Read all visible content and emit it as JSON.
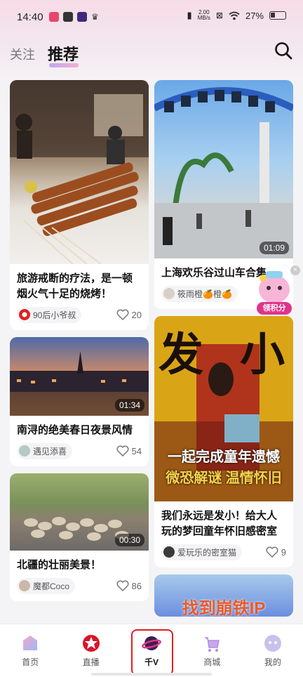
{
  "status_bar": {
    "time": "14:40",
    "net_speed_value": "2.00",
    "net_speed_unit": "MB/s",
    "battery": "27%"
  },
  "header": {
    "tab_follow": "关注",
    "tab_recommend": "推荐"
  },
  "feed": {
    "left": [
      {
        "title": "旅游戒断的疗法，是一顿烟火气十足的烧烤！",
        "author": "90后小爷叔",
        "likes": "20",
        "duration": ""
      },
      {
        "title": "南浔的绝美春日夜景风情",
        "author": "遇见添喜",
        "likes": "54",
        "duration": "01:34"
      },
      {
        "title": "北疆的壮丽美景！",
        "author": "魔都Coco",
        "likes": "86",
        "duration": "00:30"
      }
    ],
    "right": [
      {
        "title": "上海欢乐谷过山车合集",
        "author": "筱雨橙🍊橙🍊",
        "likes": "",
        "duration": "01:09"
      },
      {
        "title": "我们永远是发小！给大人玩的梦回童年怀旧感密室",
        "author": "爱玩乐的密室猫",
        "likes": "9",
        "duration": ""
      },
      {
        "title": "",
        "author": "",
        "likes": "",
        "duration": ""
      }
    ],
    "poster_big_left": "发",
    "poster_big_right": "小",
    "poster_line1": "一起完成童年遗憾",
    "poster_line2": "微恐解谜 温情怀旧",
    "poster3_text": "找到崩铁IP"
  },
  "reward": {
    "label": "领积分"
  },
  "bottom_nav": [
    {
      "label": "首页"
    },
    {
      "label": "直播"
    },
    {
      "label": "千V"
    },
    {
      "label": "商城"
    },
    {
      "label": "我的"
    }
  ],
  "colors": {
    "accent": "#e02020",
    "brand_purple": "#7b5cff"
  }
}
